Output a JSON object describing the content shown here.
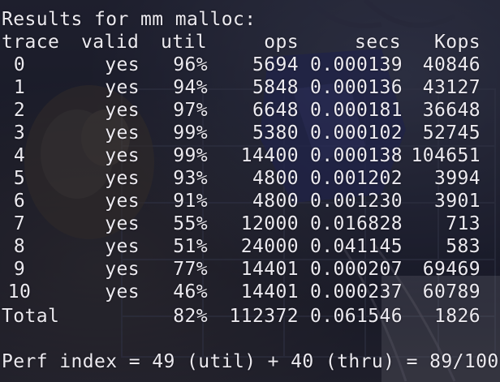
{
  "terminal": {
    "heading": "Results for mm malloc:",
    "columns": [
      "trace",
      "valid",
      "util",
      "ops",
      "secs",
      "Kops"
    ],
    "rows": [
      {
        "trace": "0",
        "valid": "yes",
        "util": "96%",
        "ops": "5694",
        "secs": "0.000139",
        "kops": "40846"
      },
      {
        "trace": "1",
        "valid": "yes",
        "util": "94%",
        "ops": "5848",
        "secs": "0.000136",
        "kops": "43127"
      },
      {
        "trace": "2",
        "valid": "yes",
        "util": "97%",
        "ops": "6648",
        "secs": "0.000181",
        "kops": "36648"
      },
      {
        "trace": "3",
        "valid": "yes",
        "util": "99%",
        "ops": "5380",
        "secs": "0.000102",
        "kops": "52745"
      },
      {
        "trace": "4",
        "valid": "yes",
        "util": "99%",
        "ops": "14400",
        "secs": "0.000138",
        "kops": "104651"
      },
      {
        "trace": "5",
        "valid": "yes",
        "util": "93%",
        "ops": "4800",
        "secs": "0.001202",
        "kops": "3994"
      },
      {
        "trace": "6",
        "valid": "yes",
        "util": "91%",
        "ops": "4800",
        "secs": "0.001230",
        "kops": "3901"
      },
      {
        "trace": "7",
        "valid": "yes",
        "util": "55%",
        "ops": "12000",
        "secs": "0.016828",
        "kops": "713"
      },
      {
        "trace": "8",
        "valid": "yes",
        "util": "51%",
        "ops": "24000",
        "secs": "0.041145",
        "kops": "583"
      },
      {
        "trace": "9",
        "valid": "yes",
        "util": "77%",
        "ops": "14401",
        "secs": "0.000207",
        "kops": "69469"
      },
      {
        "trace": "10",
        "valid": "yes",
        "util": "46%",
        "ops": "14401",
        "secs": "0.000237",
        "kops": "60789"
      }
    ],
    "total": {
      "label": "Total",
      "util": "82%",
      "ops": "112372",
      "secs": "0.061546",
      "kops": "1826"
    },
    "perf_line": "Perf index = 49 (util) + 40 (thru) = 89/100"
  },
  "colors": {
    "text": "#eceaf0",
    "background": "#1b1d2a"
  }
}
